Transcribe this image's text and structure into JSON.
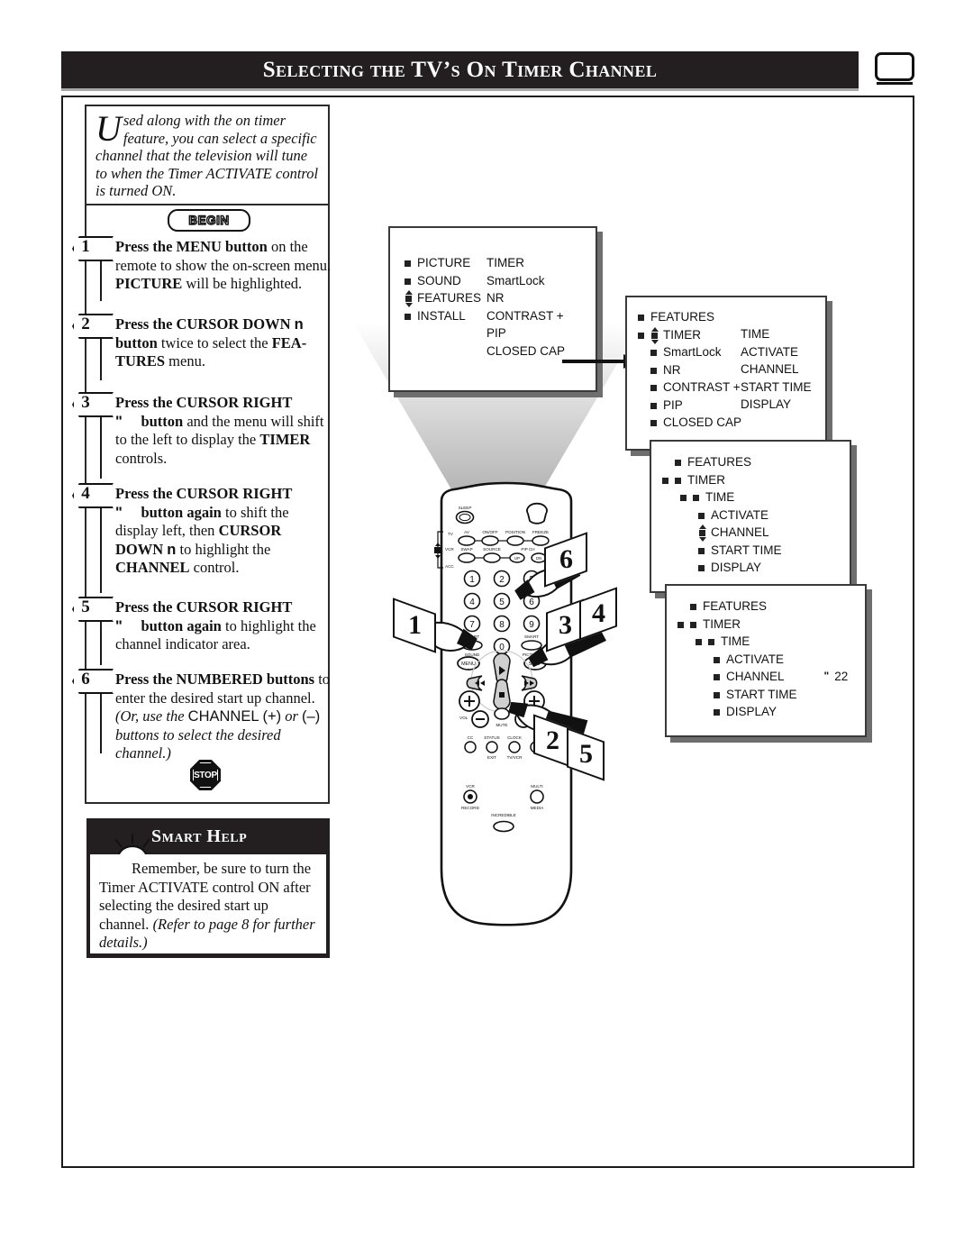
{
  "header": {
    "title": "Selecting the TV’s On Timer Channel",
    "tv_icon": "tv-icon"
  },
  "intro": {
    "dropcap": "U",
    "text": "sed along with the on timer feature, you can select a specific channel that the television will tune to when the Timer ACTIVATE control is turned ON."
  },
  "begin_badge": "BEGIN",
  "stop_badge": "STOP",
  "steps": [
    {
      "number": "1",
      "html": "<b>Press the MENU button</b> on the remote to show the on-screen menu. <b>PICTURE</b> will be highlighted."
    },
    {
      "number": "2",
      "html": "<b>Press the CURSOR DOWN</b> <span class=\"arr\">n</span> <b>button</b> twice to select the <b>FEA-TURES</b> menu."
    },
    {
      "number": "3",
      "html": "<b>Press the CURSOR RIGHT</b><br><span class=\"arr\">\"</span>&nbsp;&nbsp;&nbsp;&nbsp;&nbsp;<b>button</b> and the menu will shift to the left to display the <b>TIMER</b> controls."
    },
    {
      "number": "4",
      "html": "<b>Press the CURSOR RIGHT</b><br><span class=\"arr\">\"</span>&nbsp;&nbsp;&nbsp;&nbsp;&nbsp;<b>button again</b> to shift the display left, then <b>CURSOR DOWN</b> <span class=\"arr\">n</span> to highlight the <b>CHANNEL</b> control."
    },
    {
      "number": "5",
      "html": "<b>Press the CURSOR RIGHT</b><br><span class=\"arr\">\"</span>&nbsp;&nbsp;&nbsp;&nbsp;&nbsp;<b>button again</b> to highlight the channel indicator area."
    },
    {
      "number": "6",
      "html": "<b>Press the NUMBERED buttons</b> to enter the desired start up channel. <i>(Or, use the</i> <span class=\"sans\">CHANNEL (+)</span> <i>or</i> <span class=\"sans\">(–)</span> <i>buttons to select the desired channel.)</i>"
    }
  ],
  "smart_help": {
    "title": "Smart Help",
    "icon": "lightbulb-icon",
    "text_html": "Remember, be sure to turn the Timer ACTIVATE control ON after selecting the desired start up channel. <i>(Refer to page 8 for further details.)</i>"
  },
  "menus": [
    {
      "id": "menu-main",
      "left_column": [
        {
          "label": "PICTURE",
          "marker": "square"
        },
        {
          "label": "SOUND",
          "marker": "square"
        },
        {
          "label": "FEATURES",
          "marker": "updown"
        },
        {
          "label": "INSTALL",
          "marker": "square"
        }
      ],
      "right_column": [
        {
          "label": "TIMER"
        },
        {
          "label": "SmartLock"
        },
        {
          "label": "NR"
        },
        {
          "label": "CONTRAST +"
        },
        {
          "label": "PIP"
        },
        {
          "label": "CLOSED CAP"
        }
      ]
    },
    {
      "id": "menu-features",
      "left_column": [
        {
          "label": "FEATURES",
          "indent": 0,
          "marker": "square"
        },
        {
          "label": "TIMER",
          "indent": 0,
          "marker": "square-updown"
        },
        {
          "label": "SmartLock",
          "indent": 1,
          "marker": "square"
        },
        {
          "label": "NR",
          "indent": 1,
          "marker": "square"
        },
        {
          "label": "CONTRAST +",
          "indent": 1,
          "marker": "square"
        },
        {
          "label": "PIP",
          "indent": 1,
          "marker": "square"
        },
        {
          "label": "CLOSED CAP",
          "indent": 1,
          "marker": "square"
        }
      ],
      "right_column": [
        {
          "label": ""
        },
        {
          "label": "TIME"
        },
        {
          "label": "ACTIVATE"
        },
        {
          "label": "CHANNEL"
        },
        {
          "label": "START TIME"
        },
        {
          "label": "DISPLAY"
        }
      ]
    },
    {
      "id": "menu-timer",
      "left_column": [
        {
          "label": "FEATURES",
          "indent": 0,
          "marker": "square"
        },
        {
          "label": "TIMER",
          "indent": 0,
          "marker": "double-square"
        },
        {
          "label": "TIME",
          "indent": 1,
          "marker": "double-square"
        },
        {
          "label": "ACTIVATE",
          "indent": 2,
          "marker": "square"
        },
        {
          "label": "CHANNEL",
          "indent": 2,
          "marker": "updown"
        },
        {
          "label": "START TIME",
          "indent": 2,
          "marker": "square"
        },
        {
          "label": "DISPLAY",
          "indent": 2,
          "marker": "square"
        }
      ],
      "right_column": []
    },
    {
      "id": "menu-channel",
      "left_column": [
        {
          "label": "FEATURES",
          "indent": 0,
          "marker": "square"
        },
        {
          "label": "TIMER",
          "indent": 0,
          "marker": "double-square"
        },
        {
          "label": "TIME",
          "indent": 1,
          "marker": "double-square"
        },
        {
          "label": "ACTIVATE",
          "indent": 2,
          "marker": "square"
        },
        {
          "label": "CHANNEL",
          "indent": 2,
          "marker": "square",
          "value": "22",
          "value_marker": "\""
        },
        {
          "label": "START TIME",
          "indent": 2,
          "marker": "square"
        },
        {
          "label": "DISPLAY",
          "indent": 2,
          "marker": "square"
        }
      ],
      "right_column": []
    }
  ],
  "remote": {
    "buttons": {
      "sleep": "SLEEP",
      "power": "POWER",
      "tv": "TV",
      "vcr": "VCR",
      "acc": "ACC",
      "av": "AV",
      "onoff": "ON/OFF",
      "position": "POSITION",
      "freeze": "FREEZE",
      "swap": "SWAP",
      "source": "SOURCE",
      "pipch": "PIP CH",
      "up": "UP",
      "dn": "DN",
      "numbers": [
        "1",
        "2",
        "3",
        "4",
        "5",
        "6",
        "7",
        "8",
        "9",
        "0"
      ],
      "smart_sound": "SMART SOUND",
      "smart_picture": "SMART PICTURE",
      "menu": "MENU",
      "surf": "SURF",
      "vol": "VOL",
      "ch": "CH",
      "mute": "MUTE",
      "cc": "CC",
      "status": "STATUS",
      "exit": "EXIT",
      "clock": "CLOCK",
      "tvvcr": "TV/VCR",
      "vcr_record": "VCR RECORD",
      "incredible": "INCREDIBLE",
      "multi_media": "MULTI MEDIA"
    },
    "callouts": [
      "1",
      "2",
      "3",
      "4",
      "5",
      "6"
    ]
  }
}
